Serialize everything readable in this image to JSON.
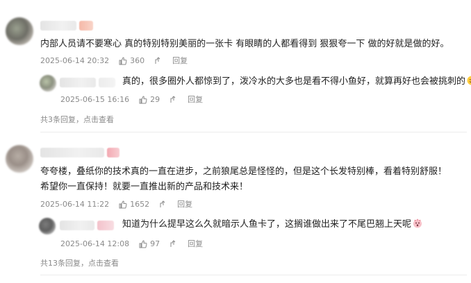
{
  "comments": [
    {
      "text": "内部人员请不要寒心 真的特别特别美丽的一张卡 有眼睛的人都看得到 狠狠夸一下 做的好就是做的好。",
      "date": "2025-06-14 20:32",
      "likes": "360",
      "reply_label": "回复",
      "reply": {
        "text": "真的，很多圈外人都惊到了，泼冷水的大多也是看不得小鱼好，就算再好也会被挑刺的",
        "date": "2025-06-15 16:16",
        "likes": "29",
        "reply_label": "回复",
        "emoji": "sweat-smile-emoji"
      },
      "more_text": "共3条回复，点击查看"
    },
    {
      "line1": "夸夸楼，叠纸你的技术真的一直在进步，之前狼尾总是怪怪的，但是这个长发特别棒，看着特别舒服！",
      "line2": "希望你一直保持！就要一直推出新的产品和技术来！",
      "date": "2025-06-14 11:22",
      "likes": "1652",
      "reply_label": "回复",
      "reply": {
        "text": "知道为什么提早这么久就暗示人鱼卡了，这搁谁做出来了不尾巴翘上天呢",
        "date": "2025-06-14 12:08",
        "likes": "97",
        "reply_label": "回复",
        "emoji": "surprised-face-emoji"
      },
      "more_text": "共13条回复，点击查看"
    }
  ],
  "colors": {
    "meta": "#8a8a8a",
    "text": "#222222",
    "divider": "#ececec"
  }
}
